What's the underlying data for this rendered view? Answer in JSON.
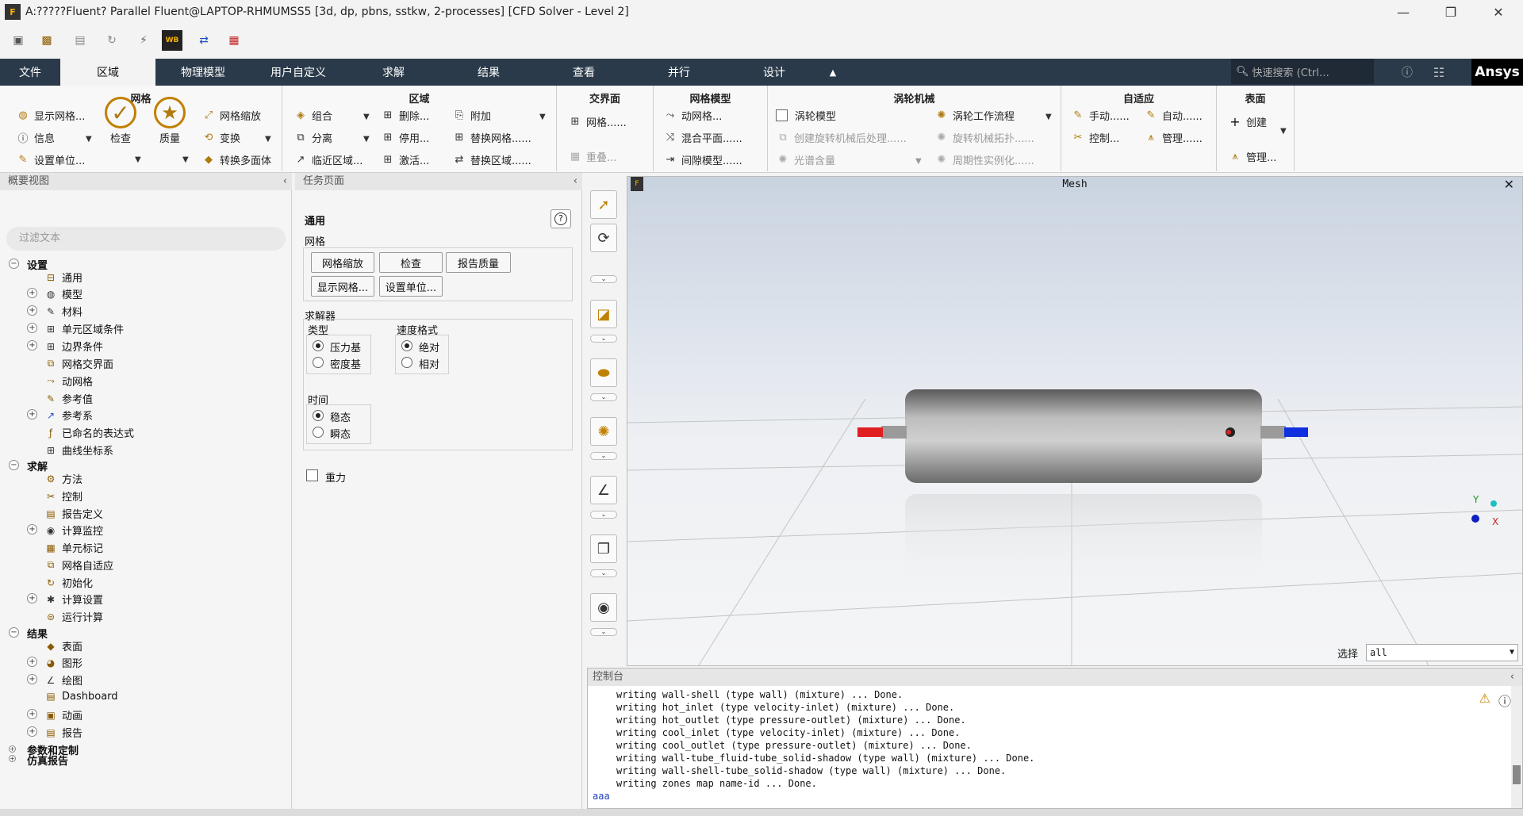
{
  "window": {
    "title": "A:?????Fluent? Parallel Fluent@LAPTOP-RHMUMSS5  [3d, dp, pbns, sstkw, 2-processes] [CFD Solver - Level 2]",
    "app_icon": "F",
    "minimize": "—",
    "maximize": "❐",
    "close": "✕"
  },
  "quick_access": {
    "icons": [
      "open-case-icon",
      "open-data-icon",
      "save-icon",
      "reload-icon",
      "flash-icon",
      "workbench-icon",
      "parameters-icon",
      "mosaic-icon"
    ],
    "wb_label": "WB"
  },
  "ribbon_tabs": [
    "文件",
    "区域",
    "物理模型",
    "用户自定义",
    "求解",
    "结果",
    "查看",
    "并行",
    "设计"
  ],
  "active_tab": "区域",
  "search": {
    "placeholder": "快速搜索 (Ctrl…"
  },
  "brand": "Ansys",
  "ribbon": {
    "mesh": {
      "title": "网格",
      "display": "显示网格...",
      "info": "信息",
      "units": "设置单位...",
      "check": "检查",
      "quality": "质量",
      "scale": "网格缩放",
      "transform": "变换",
      "polyhedra": "转换多面体"
    },
    "zones": {
      "title": "区域",
      "combine": "组合",
      "separate": "分离",
      "adjacency": "临近区域...",
      "delete": "删除...",
      "deactivate": "停用...",
      "activate": "激活...",
      "append": "附加",
      "replace_mesh": "替换网格......",
      "replace_zone": "替换区域......"
    },
    "interfaces": {
      "title": "交界面",
      "mesh": "网格......",
      "overlap": "重叠..."
    },
    "mesh_models": {
      "title": "网格模型",
      "dynamic": "动网格...",
      "mixing_plane": "混合平面......",
      "gap": "间隙模型......"
    },
    "turbo": {
      "title": "涡轮机械",
      "model": "涡轮模型",
      "workflow": "涡轮工作流程",
      "postproc": "创建旋转机械后处理......",
      "topology": "旋转机械拓扑......",
      "spectral": "光谱含量",
      "periodic": "周期性实例化......"
    },
    "adaption": {
      "title": "自适应",
      "manual": "手动......",
      "auto": "自动......",
      "controls": "控制...",
      "manage": "管理......"
    },
    "surface": {
      "title": "表面",
      "create": "创建",
      "manage": "管理..."
    }
  },
  "tree": {
    "header": "概要视图",
    "filter_placeholder": "过滤文本",
    "nodes": [
      {
        "label": "设置",
        "bold": true
      },
      {
        "label": "通用"
      },
      {
        "label": "模型"
      },
      {
        "label": "材料"
      },
      {
        "label": "单元区域条件"
      },
      {
        "label": "边界条件"
      },
      {
        "label": "网格交界面"
      },
      {
        "label": "动网格"
      },
      {
        "label": "参考值"
      },
      {
        "label": "参考系"
      },
      {
        "label": "已命名的表达式"
      },
      {
        "label": "曲线坐标系"
      },
      {
        "label": "求解",
        "bold": true
      },
      {
        "label": "方法"
      },
      {
        "label": "控制"
      },
      {
        "label": "报告定义"
      },
      {
        "label": "计算监控"
      },
      {
        "label": "单元标记"
      },
      {
        "label": "网格自适应"
      },
      {
        "label": "初始化"
      },
      {
        "label": "计算设置"
      },
      {
        "label": "运行计算"
      },
      {
        "label": "结果",
        "bold": true
      },
      {
        "label": "表面"
      },
      {
        "label": "图形"
      },
      {
        "label": "绘图"
      },
      {
        "label": "Dashboard"
      },
      {
        "label": "动画"
      },
      {
        "label": "报告"
      },
      {
        "label": "参数和定制",
        "bold": true
      },
      {
        "label": "仿真报告",
        "bold": true
      }
    ]
  },
  "task": {
    "header": "任务页面",
    "section_title": "通用",
    "help": "?",
    "mesh_label": "网格",
    "buttons": [
      "网格缩放",
      "检查",
      "报告质量",
      "显示网格...",
      "设置单位..."
    ],
    "solver_label": "求解器",
    "type_label": "类型",
    "type_options": [
      "压力基",
      "密度基"
    ],
    "type_selected": "压力基",
    "velocity_label": "速度格式",
    "velocity_options": [
      "绝对",
      "相对"
    ],
    "velocity_selected": "绝对",
    "time_label": "时间",
    "time_options": [
      "稳态",
      "瞬态"
    ],
    "time_selected": "稳态",
    "gravity": "重力",
    "gravity_checked": false
  },
  "viewport": {
    "title": "Mesh",
    "select_label": "选择",
    "select_value": "all",
    "close": "✕"
  },
  "console": {
    "header": "控制台",
    "lines": [
      "writing wall-shell (type wall) (mixture) ... Done.",
      "writing hot_inlet (type velocity-inlet) (mixture) ... Done.",
      "writing hot_outlet (type pressure-outlet) (mixture) ... Done.",
      "writing cool_inlet (type velocity-inlet) (mixture) ... Done.",
      "writing cool_outlet (type pressure-outlet) (mixture) ... Done.",
      "writing wall-tube_fluid-tube_solid-shadow (type wall) (mixture) ... Done.",
      "writing wall-shell-tube_solid-shadow (type wall) (mixture) ... Done.",
      "writing zones map name-id ... Done."
    ],
    "input": "aaa"
  },
  "colors": {
    "ribbon_bg": "#2b3a4a",
    "accent": "#c08000",
    "inlet_red": "#e02020",
    "outlet_blue": "#1030e0"
  }
}
